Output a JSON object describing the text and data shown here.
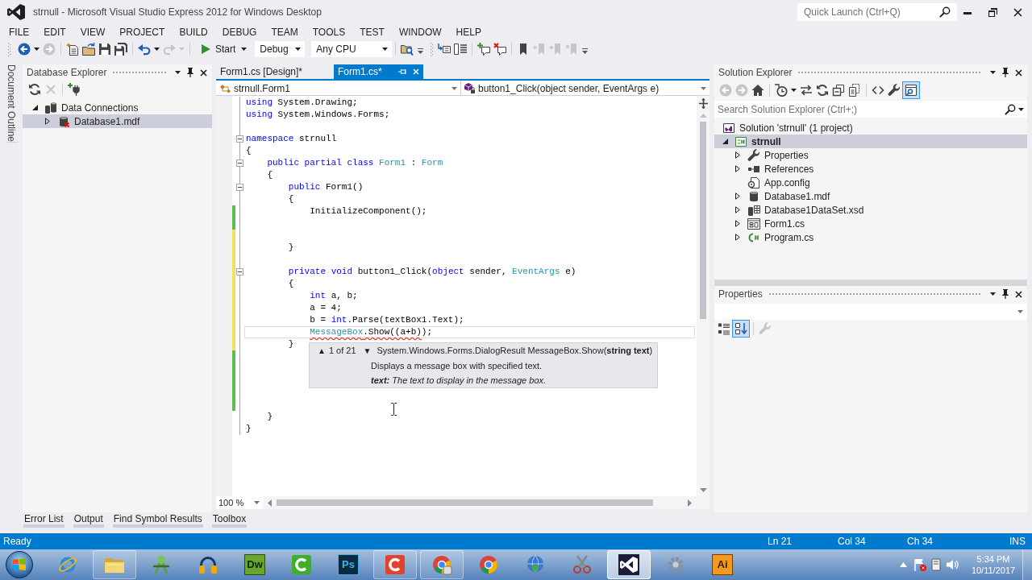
{
  "window": {
    "title": "strnull - Microsoft Visual Studio Express 2012 for Windows Desktop",
    "quick_launch": {
      "placeholder": "Quick Launch (Ctrl+Q)"
    }
  },
  "menu": [
    {
      "label": "FILE"
    },
    {
      "label": "EDIT"
    },
    {
      "label": "VIEW"
    },
    {
      "label": "PROJECT"
    },
    {
      "label": "BUILD"
    },
    {
      "label": "DEBUG"
    },
    {
      "label": "TEAM"
    },
    {
      "label": "TOOLS"
    },
    {
      "label": "TEST"
    },
    {
      "label": "WINDOW"
    },
    {
      "label": "HELP"
    }
  ],
  "toolbars": [
    {
      "groups": [
        [
          {
            "kind": "back",
            "disabled": false
          },
          {
            "kind": "caret",
            "disabled": false
          },
          {
            "kind": "forward",
            "disabled": true
          }
        ],
        [
          {
            "kind": "new_project",
            "disabled": false
          },
          {
            "kind": "open_file",
            "disabled": false
          },
          {
            "kind": "save",
            "disabled": false
          },
          {
            "kind": "save_all",
            "disabled": false
          }
        ],
        [
          {
            "kind": "undo",
            "disabled": false
          },
          {
            "kind": "caret",
            "disabled": false
          },
          {
            "kind": "redo",
            "disabled": true
          },
          {
            "kind": "caret",
            "disabled": true
          }
        ],
        [
          {
            "kind": "start",
            "label": "Start",
            "disabled": false
          },
          {
            "kind": "combo",
            "value": "Debug",
            "disabled": false
          },
          {
            "kind": "combo",
            "value": "Any CPU",
            "disabled": false
          }
        ],
        [
          {
            "kind": "find_files",
            "disabled": false
          },
          {
            "kind": "overflow",
            "disabled": false
          }
        ]
      ]
    },
    {
      "groups": [
        [
          {
            "kind": "arrow_box",
            "disabled": false
          },
          {
            "kind": "list_box",
            "disabled": false
          }
        ],
        [
          {
            "kind": "comment_add",
            "disabled": false
          },
          {
            "kind": "comment_remove",
            "disabled": false
          }
        ],
        [
          {
            "kind": "bookmark",
            "disabled": false
          },
          {
            "kind": "bookmark_prev",
            "disabled": true
          },
          {
            "kind": "bookmark_next",
            "disabled": true
          },
          {
            "kind": "bookmark_clear",
            "disabled": true
          },
          {
            "kind": "overflow",
            "disabled": false
          }
        ]
      ]
    }
  ],
  "side_tabs": [
    {
      "label": "Document Outline"
    }
  ],
  "database_explorer": {
    "title": "Database Explorer",
    "toolbar": [
      [
        {
          "kind": "refresh",
          "disabled": false
        },
        {
          "kind": "delete",
          "disabled": true
        }
      ],
      [
        {
          "kind": "connect",
          "disabled": false
        }
      ]
    ],
    "tree": [
      {
        "label": "Data Connections",
        "kind": "connections",
        "expanded": true,
        "selected": false,
        "children": [
          {
            "label": "Database1.mdf",
            "kind": "database_error",
            "expanded": false,
            "selected": true
          }
        ]
      }
    ]
  },
  "editor": {
    "tabs": [
      {
        "label": "Form1.cs [Design]*",
        "selected": false
      },
      {
        "label": "Form1.cs*",
        "selected": true
      }
    ],
    "type_scope": "strnull.Form1",
    "member_scope": "button1_Click(object sender, EventArgs e)",
    "lines": [
      {
        "tokens": [
          {
            "kind": "keyword",
            "text": "using"
          },
          {
            "kind": "plain",
            "text": " System.Drawing;"
          }
        ],
        "foldable": false,
        "current": false
      },
      {
        "tokens": [
          {
            "kind": "keyword",
            "text": "using"
          },
          {
            "kind": "plain",
            "text": " System.Windows.Forms;"
          }
        ],
        "foldable": false,
        "current": false
      },
      {
        "foldable": false,
        "current": false
      },
      {
        "tokens": [
          {
            "kind": "keyword",
            "text": "namespace"
          },
          {
            "kind": "plain",
            "text": " strnull"
          }
        ],
        "foldable": true,
        "current": false
      },
      {
        "tokens": [
          {
            "kind": "plain",
            "text": "{"
          }
        ],
        "foldable": false,
        "current": false
      },
      {
        "tokens": [
          {
            "kind": "keyword",
            "text": "    public"
          },
          {
            "kind": "keyword",
            "text": " partial"
          },
          {
            "kind": "keyword",
            "text": " class"
          },
          {
            "kind": "type",
            "text": " Form1"
          },
          {
            "kind": "plain",
            "text": " : "
          },
          {
            "kind": "type",
            "text": "Form"
          }
        ],
        "foldable": true,
        "current": false
      },
      {
        "tokens": [
          {
            "kind": "plain",
            "text": "    {"
          }
        ],
        "foldable": false,
        "current": false
      },
      {
        "tokens": [
          {
            "kind": "keyword",
            "text": "        public"
          },
          {
            "kind": "plain",
            "text": " Form1()"
          }
        ],
        "foldable": true,
        "current": false
      },
      {
        "tokens": [
          {
            "kind": "plain",
            "text": "        {"
          }
        ],
        "foldable": false,
        "current": false
      },
      {
        "tokens": [
          {
            "kind": "plain",
            "text": "            InitializeComponent();"
          }
        ],
        "foldable": false,
        "current": false,
        "color": "#5cbf4e"
      },
      {
        "foldable": false,
        "current": false,
        "color": "#5cbf4e"
      },
      {
        "foldable": false,
        "current": false,
        "color": "#f0e25a"
      },
      {
        "tokens": [
          {
            "kind": "plain",
            "text": "        }"
          }
        ],
        "foldable": false,
        "current": false,
        "color": "#f0e25a"
      },
      {
        "foldable": false,
        "current": false,
        "color": "#f0e25a"
      },
      {
        "tokens": [
          {
            "kind": "keyword",
            "text": "        private"
          },
          {
            "kind": "keyword",
            "text": " void"
          },
          {
            "kind": "plain",
            "text": " button1_Click("
          },
          {
            "kind": "keyword",
            "text": "object"
          },
          {
            "kind": "plain",
            "text": " sender, "
          },
          {
            "kind": "type",
            "text": "EventArgs"
          },
          {
            "kind": "plain",
            "text": " e)"
          }
        ],
        "foldable": true,
        "current": false,
        "color": "#f0e25a"
      },
      {
        "tokens": [
          {
            "kind": "plain",
            "text": "        {"
          }
        ],
        "foldable": false,
        "current": false,
        "color": "#f0e25a"
      },
      {
        "tokens": [
          {
            "kind": "keyword",
            "text": "            int"
          },
          {
            "kind": "plain",
            "text": " a, b;"
          }
        ],
        "foldable": false,
        "current": false,
        "color": "#f0e25a"
      },
      {
        "tokens": [
          {
            "kind": "plain",
            "text": "            a = 4;"
          }
        ],
        "foldable": false,
        "current": false,
        "color": "#f0e25a"
      },
      {
        "tokens": [
          {
            "kind": "plain",
            "text": "            b = "
          },
          {
            "kind": "keyword",
            "text": "int"
          },
          {
            "kind": "plain",
            "text": ".Parse(textBox1.Text);"
          }
        ],
        "foldable": false,
        "current": false,
        "color": "#f0e25a"
      },
      {
        "tokens": [
          {
            "kind": "type",
            "text": "            MessageBox",
            "error": true
          },
          {
            "kind": "plain",
            "text": ".Show((a+b)",
            "error": true
          },
          {
            "kind": "plain",
            "text": ");",
            "error": false
          }
        ],
        "foldable": false,
        "current": true,
        "color": "#f0e25a"
      },
      {
        "tokens": [
          {
            "kind": "plain",
            "text": "        }"
          }
        ],
        "foldable": false,
        "current": false,
        "color": "#f0e25a"
      },
      {
        "foldable": false,
        "current": false,
        "color": "#5cbf4e"
      },
      {
        "foldable": false,
        "current": false,
        "color": "#5cbf4e"
      },
      {
        "foldable": false,
        "current": false,
        "color": "#5cbf4e"
      },
      {
        "foldable": false,
        "current": false,
        "color": "#5cbf4e"
      },
      {
        "foldable": false,
        "current": false,
        "color": "#5cbf4e"
      },
      {
        "tokens": [
          {
            "kind": "plain",
            "text": "    }"
          }
        ],
        "foldable": false,
        "current": false
      },
      {
        "tokens": [
          {
            "kind": "plain",
            "text": "}"
          }
        ],
        "foldable": false,
        "current": false
      }
    ],
    "parameter_info": {
      "previous": "▲",
      "counter": "1 of 21",
      "next": "▼",
      "signature": "System.Windows.Forms.DialogResult MessageBox.Show(**string text**)",
      "summary": "Displays a message box with specified text.",
      "parameter": "**text:** The text to display in the message box."
    },
    "zoom": "100 %"
  },
  "solution_explorer": {
    "title": "Solution Explorer",
    "toolbar": [
      [
        {
          "kind": "back",
          "disabled": true,
          "on": false
        },
        {
          "kind": "forward",
          "disabled": true,
          "on": false
        },
        {
          "kind": "home",
          "disabled": false,
          "on": false
        }
      ],
      [
        {
          "kind": "pending_changes",
          "disabled": false,
          "on": false
        },
        {
          "kind": "caret",
          "disabled": false,
          "on": false
        },
        {
          "kind": "sync",
          "disabled": false,
          "on": false
        },
        {
          "kind": "refresh",
          "disabled": false,
          "on": false
        },
        {
          "kind": "collapse_all",
          "disabled": false,
          "on": false
        },
        {
          "kind": "show_all_files",
          "disabled": false,
          "on": false
        }
      ],
      [
        {
          "kind": "view_code",
          "disabled": false,
          "on": false
        },
        {
          "kind": "properties",
          "disabled": false,
          "on": false
        },
        {
          "kind": "preview",
          "disabled": false,
          "on": true
        }
      ]
    ],
    "search": {
      "placeholder": "Search Solution Explorer (Ctrl+;)"
    },
    "tree": [
      {
        "label": "Solution 'strnull' (1 project)",
        "kind": "solution",
        "selected": false,
        "children": [
          {
            "label": "strnull",
            "kind": "csproj",
            "expanded": true,
            "selected": true,
            "startup": true,
            "children": [
              {
                "label": "Properties",
                "kind": "wrench",
                "expanded": false,
                "selected": false
              },
              {
                "label": "References",
                "kind": "references",
                "expanded": false,
                "selected": false
              },
              {
                "label": "App.config",
                "kind": "config",
                "selected": false
              },
              {
                "label": "Database1.mdf",
                "kind": "database",
                "expanded": false,
                "selected": false
              },
              {
                "label": "Database1DataSet.xsd",
                "kind": "dataset",
                "expanded": false,
                "selected": false
              },
              {
                "label": "Form1.cs",
                "kind": "form",
                "expanded": false,
                "selected": false
              },
              {
                "label": "Program.cs",
                "kind": "csfile",
                "expanded": false,
                "selected": false
              }
            ]
          }
        ]
      }
    ]
  },
  "properties": {
    "title": "Properties",
    "toolbar": [
      [
        {
          "kind": "categorized",
          "disabled": false,
          "on": false
        },
        {
          "kind": "alphabetical",
          "disabled": false,
          "on": true
        }
      ],
      [
        {
          "kind": "properties",
          "disabled": true,
          "on": false
        }
      ]
    ]
  },
  "bottom_tabs": [
    {
      "label": "Error List"
    },
    {
      "label": "Output"
    },
    {
      "label": "Find Symbol Results"
    },
    {
      "label": "Toolbox"
    }
  ],
  "status_bar": {
    "message": "Ready",
    "line": "Ln 21",
    "column": "Col 34",
    "character": "Ch 34",
    "mode": "INS"
  },
  "taskbar": {
    "apps": [
      {
        "kind": "ie",
        "running": false,
        "selected": false
      },
      {
        "kind": "explorer",
        "running": true,
        "selected": false
      },
      {
        "kind": "android",
        "running": false,
        "selected": false
      },
      {
        "kind": "audio",
        "running": false,
        "selected": false
      },
      {
        "kind": "dreamweaver",
        "label": "Dw",
        "running": false,
        "selected": false
      },
      {
        "kind": "camtasia",
        "running": false,
        "selected": false
      },
      {
        "kind": "photoshop",
        "label": "Ps",
        "running": false,
        "selected": false
      },
      {
        "kind": "recorder",
        "running": true,
        "selected": false
      },
      {
        "kind": "remote",
        "running": true,
        "selected": false
      },
      {
        "kind": "chrome",
        "running": false,
        "selected": false
      },
      {
        "kind": "download",
        "running": false,
        "selected": false
      },
      {
        "kind": "snipping",
        "running": false,
        "selected": false
      },
      {
        "kind": "visual_studio",
        "running": true,
        "selected": true
      },
      {
        "kind": "utility",
        "running": false,
        "selected": false
      },
      {
        "kind": "illustrator",
        "label": "Ai",
        "running": false,
        "selected": false
      }
    ],
    "clock": {
      "time": "5:34 PM",
      "date": "10/11/2017"
    }
  }
}
